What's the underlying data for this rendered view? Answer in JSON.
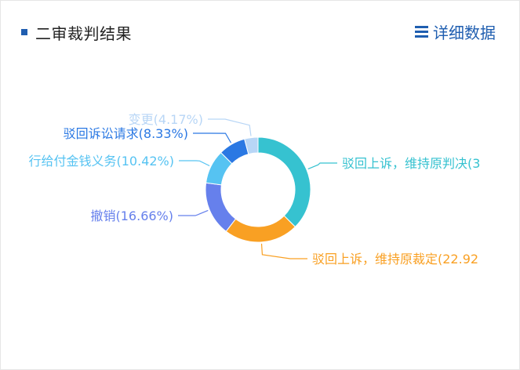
{
  "header": {
    "title": "二审裁判结果",
    "detail_label": "详细数据",
    "detail_icon": "menu-icon"
  },
  "chart_data": {
    "type": "pie",
    "variant": "donut",
    "title": "二审裁判结果",
    "slices": [
      {
        "label": "驳回上诉，维持原判决(3",
        "value": 37.5,
        "color": "#36c2d0"
      },
      {
        "label": "驳回上诉，维持原裁定(22.92",
        "value": 22.92,
        "color": "#f9a023"
      },
      {
        "label": "撤销(16.66%)",
        "value": 16.66,
        "color": "#6680ec"
      },
      {
        "label": "行给付金钱义务(10.42%)",
        "value": 10.42,
        "color": "#56c3f2"
      },
      {
        "label": "驳回诉讼请求(8.33%)",
        "value": 8.33,
        "color": "#2a78e3"
      },
      {
        "label": "变更(4.17%)",
        "value": 4.17,
        "color": "#b8d6f6"
      }
    ]
  }
}
